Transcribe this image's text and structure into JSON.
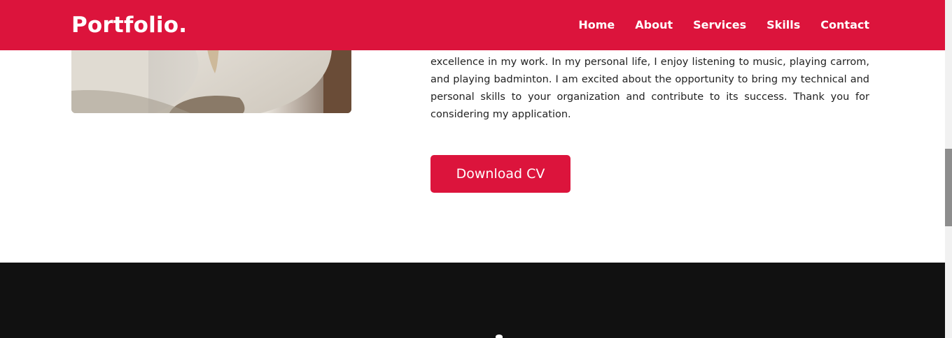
{
  "header": {
    "brand": "Portfolio.",
    "nav": [
      {
        "label": "Home"
      },
      {
        "label": "About"
      },
      {
        "label": "Services"
      },
      {
        "label": "Skills"
      },
      {
        "label": "Contact"
      }
    ]
  },
  "about": {
    "text": "part of a team. I am well-organized, meet deadlines easily, and always strive for excellence in my work. In my personal life, I enjoy listening to music, playing carrom, and playing badminton. I am excited about the opportunity to bring my technical and personal skills to your organization and contribute to its success. Thank you for considering my application.",
    "button_label": "Download CV"
  },
  "colors": {
    "accent": "#dc143c",
    "footer": "#111111",
    "text": "#222222"
  }
}
